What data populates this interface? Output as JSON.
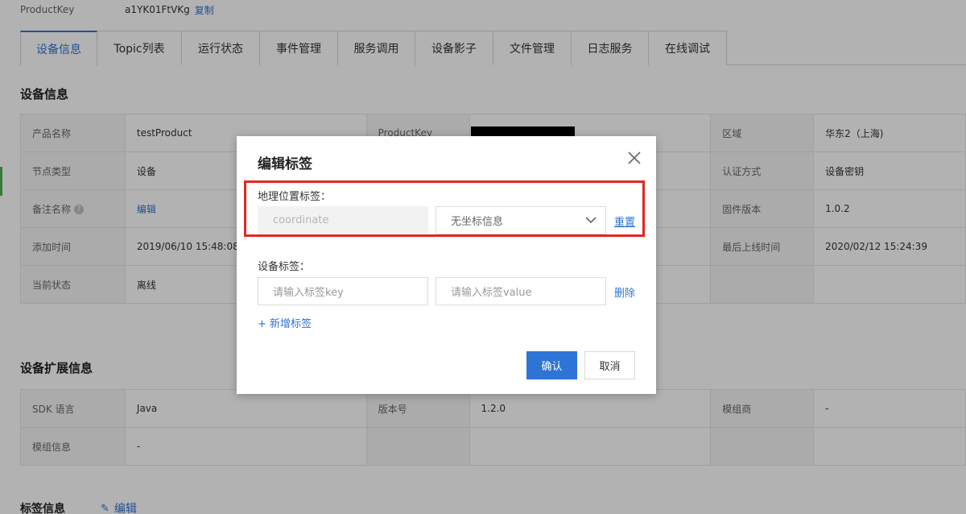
{
  "product_key": {
    "label": "ProductKey",
    "value": "a1YK01FtVKg",
    "copy_label": "复制"
  },
  "tabs": [
    {
      "label": "设备信息",
      "active": true
    },
    {
      "label": "Topic列表"
    },
    {
      "label": "运行状态"
    },
    {
      "label": "事件管理"
    },
    {
      "label": "服务调用"
    },
    {
      "label": "设备影子"
    },
    {
      "label": "文件管理"
    },
    {
      "label": "日志服务"
    },
    {
      "label": "在线调试"
    }
  ],
  "device_info": {
    "title": "设备信息",
    "rows": [
      [
        {
          "k": "产品名称",
          "v": "testProduct"
        },
        {
          "k": "ProductKey",
          "v": ""
        },
        {
          "k": "区域",
          "v": "华东2（上海)"
        }
      ],
      [
        {
          "k": "节点类型",
          "v": "设备"
        },
        {
          "k": "",
          "v": ""
        },
        {
          "k": "认证方式",
          "v": "设备密钥"
        }
      ],
      [
        {
          "k": "备注名称",
          "v": "编辑"
        },
        {
          "k": "",
          "v": ""
        },
        {
          "k": "固件版本",
          "v": "1.0.2"
        }
      ],
      [
        {
          "k": "添加时间",
          "v": "2019/06/10 15:48:08"
        },
        {
          "k": "",
          "v": ""
        },
        {
          "k": "最后上线时间",
          "v": "2020/02/12 15:24:39"
        }
      ],
      [
        {
          "k": "当前状态",
          "v": "离线"
        },
        {
          "k": "",
          "v": ""
        },
        {
          "k": "",
          "v": ""
        }
      ]
    ]
  },
  "ext_info": {
    "title": "设备扩展信息",
    "rows": [
      [
        {
          "k": "SDK 语言",
          "v": "Java"
        },
        {
          "k": "版本号",
          "v": "1.2.0"
        },
        {
          "k": "模组商",
          "v": "-"
        }
      ],
      [
        {
          "k": "模组信息",
          "v": "-"
        },
        {
          "k": "",
          "v": ""
        },
        {
          "k": "",
          "v": ""
        }
      ]
    ]
  },
  "tag_info": {
    "title": "标签信息",
    "edit_label": "编辑"
  },
  "modal": {
    "title": "编辑标签",
    "geo_label": "地理位置标签：",
    "geo_placeholder": "coordinate",
    "geo_select": "无坐标信息",
    "reset_label": "重置",
    "device_tag_label": "设备标签：",
    "key_placeholder": "请输入标签key",
    "value_placeholder": "请输入标签value",
    "delete_label": "删除",
    "add_tag_label": "+ 新增标签",
    "confirm_label": "确认",
    "cancel_label": "取消"
  },
  "colors": {
    "accent": "#2e74d6",
    "highlight": "#e5261f"
  }
}
